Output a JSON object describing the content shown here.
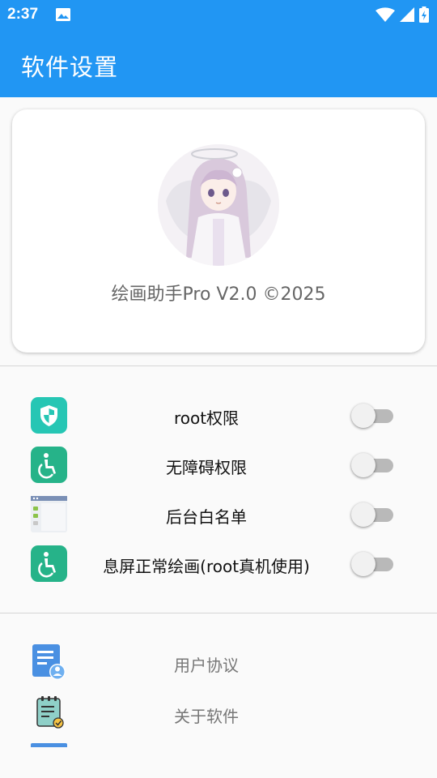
{
  "status_bar": {
    "time": "2:37",
    "icons": [
      "image-icon",
      "wifi-icon",
      "cell-signal-icon",
      "battery-icon"
    ]
  },
  "app_bar": {
    "title": "软件设置"
  },
  "profile": {
    "avatar": "avatar-anime-angel-girl",
    "version_text": "绘画助手Pro V2.0 ©2025"
  },
  "settings": [
    {
      "label": "root权限",
      "icon": "shield-icon",
      "enabled": false
    },
    {
      "label": "无障碍权限",
      "icon": "accessibility-icon",
      "enabled": false
    },
    {
      "label": "后台白名单",
      "icon": "app-window-icon",
      "enabled": false
    },
    {
      "label": "息屏正常绘画(root真机使用)",
      "icon": "accessibility-icon",
      "enabled": false
    }
  ],
  "menu": [
    {
      "label": "用户协议",
      "icon": "user-agreement-icon"
    },
    {
      "label": "关于软件",
      "icon": "clipboard-check-icon"
    }
  ],
  "colors": {
    "primary": "#2196f3",
    "icon_teal": "#26c6b4",
    "icon_green": "#26b389",
    "toggle_off_track": "#b9b9b9",
    "toggle_off_thumb": "#f1f1f1"
  }
}
